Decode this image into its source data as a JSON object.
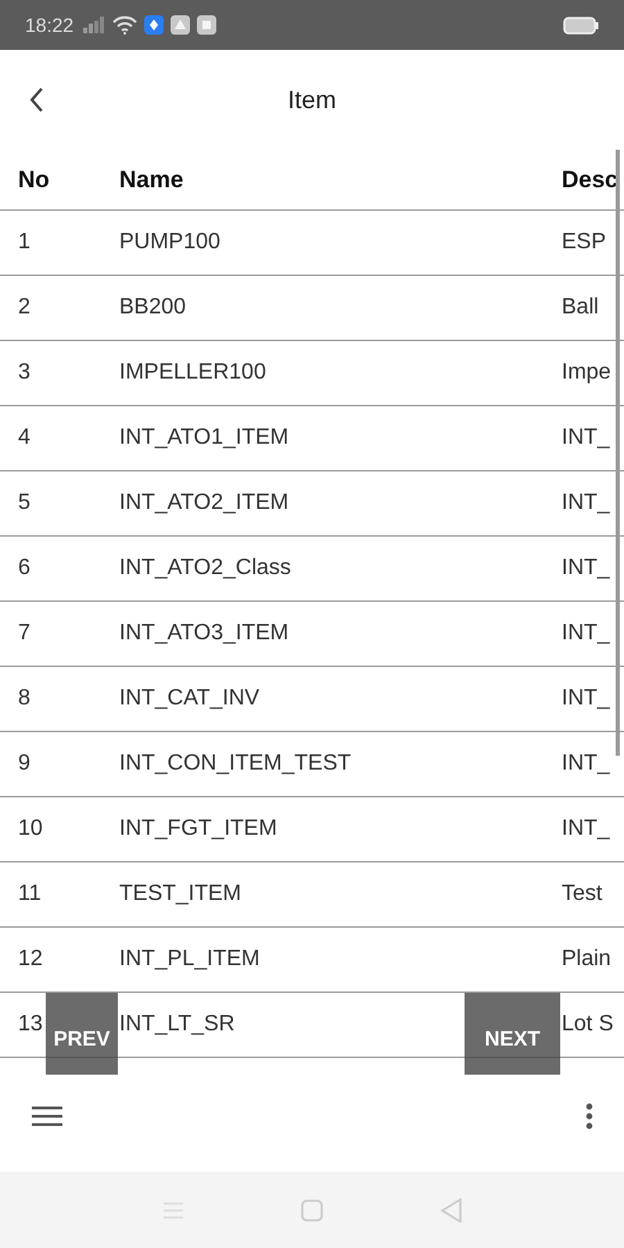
{
  "status_bar": {
    "time": "18:22"
  },
  "header": {
    "title": "Item"
  },
  "table": {
    "columns": [
      "No",
      "Name",
      "Desc"
    ],
    "rows": [
      [
        "1",
        "PUMP100",
        "ESP"
      ],
      [
        "2",
        "BB200",
        "Ball"
      ],
      [
        "3",
        "IMPELLER100",
        "Impe"
      ],
      [
        "4",
        "INT_ATO1_ITEM",
        "INT_"
      ],
      [
        "5",
        "INT_ATO2_ITEM",
        "INT_"
      ],
      [
        "6",
        "INT_ATO2_Class",
        "INT_"
      ],
      [
        "7",
        "INT_ATO3_ITEM",
        "INT_"
      ],
      [
        "8",
        "INT_CAT_INV",
        "INT_"
      ],
      [
        "9",
        "INT_CON_ITEM_TEST",
        "INT_"
      ],
      [
        "10",
        "INT_FGT_ITEM",
        "INT_"
      ],
      [
        "11",
        "TEST_ITEM",
        "Test"
      ],
      [
        "12",
        "INT_PL_ITEM",
        "Plain"
      ],
      [
        "13",
        "INT_LT_SR",
        "Lot S"
      ]
    ]
  },
  "pager": {
    "prev": "PREV",
    "next": "NEXT"
  }
}
